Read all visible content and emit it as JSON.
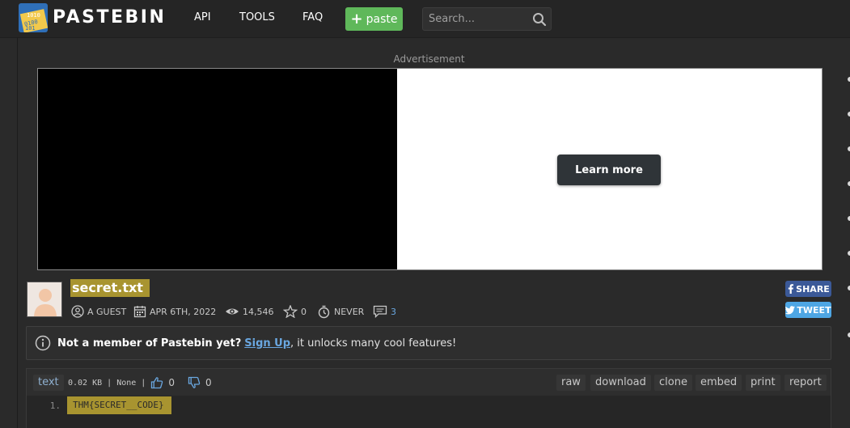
{
  "header": {
    "brand": "PASTEBIN",
    "nav": [
      {
        "label": "API"
      },
      {
        "label": "TOOLS"
      },
      {
        "label": "FAQ"
      }
    ],
    "paste_button": "paste",
    "search_placeholder": "Search..."
  },
  "ad": {
    "label": "Advertisement",
    "cta": "Learn more"
  },
  "paste": {
    "title": "secret.txt",
    "author": "A GUEST",
    "date": "APR 6TH, 2022",
    "views": "14,546",
    "rating": "0",
    "expires": "NEVER",
    "comments": "3"
  },
  "share": {
    "facebook": "SHARE",
    "twitter": "TWEET"
  },
  "notice": {
    "bold": "Not a member of Pastebin yet?",
    "link": "Sign Up",
    "rest": ", it unlocks many cool features!"
  },
  "code": {
    "syntax": "text",
    "size": "0.02 KB",
    "separator": "|",
    "category": "None",
    "likes": "0",
    "dislikes": "0",
    "actions": [
      "raw",
      "download",
      "clone",
      "embed",
      "print",
      "report"
    ],
    "lines": [
      {
        "number": "1.",
        "text": "THM{SECRET__CODE}"
      }
    ]
  },
  "colors": {
    "background": "#2a2a2a",
    "accent_green": "#5fb85a",
    "highlight": "#a89430",
    "link_blue": "#6aa7e0",
    "facebook": "#3b5998",
    "twitter": "#4ea6e4"
  }
}
